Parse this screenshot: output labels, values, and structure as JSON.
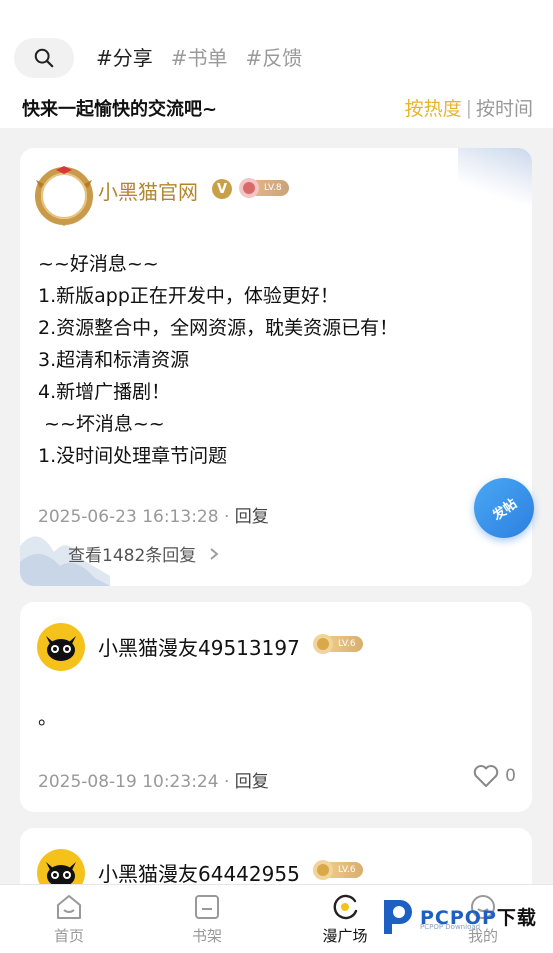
{
  "header": {
    "tags": [
      {
        "label": "#分享",
        "active": true
      },
      {
        "label": "#书单",
        "active": false
      },
      {
        "label": "#反馈",
        "active": false
      }
    ],
    "subtitle": "快来一起愉快的交流吧~",
    "sort": {
      "hot": "按热度",
      "time": "按时间",
      "selected": "hot"
    }
  },
  "posts": [
    {
      "username": "小黑猫官网",
      "verified_badge": "V",
      "level": "LV.8",
      "content": "~~好消息~~\n1.新版app正在开发中，体验更好！\n2.资源整合中，全网资源，耽美资源已有！\n3.超清和标清资源\n4.新增广播剧！\n ~~坏消息~~\n1.没时间处理章节问题",
      "timestamp": "2025-06-23 16:13:28",
      "reply_label": "回复",
      "view_replies": "查看1482条回复"
    },
    {
      "username": "小黑猫漫友49513197",
      "level": "LV.6",
      "avatar_text": "小黑猫",
      "content": "。",
      "timestamp": "2025-08-19 10:23:24",
      "reply_label": "回复",
      "likes": "0"
    },
    {
      "username": "小黑猫漫友64442955",
      "level": "LV.6"
    }
  ],
  "fab": {
    "label": "发帖"
  },
  "tabbar": [
    {
      "label": "首页",
      "icon": "home-icon",
      "active": false
    },
    {
      "label": "书架",
      "icon": "bookshelf-icon",
      "active": false
    },
    {
      "label": "漫广场",
      "icon": "plaza-icon",
      "active": true
    },
    {
      "label": "我的",
      "icon": "profile-icon",
      "active": false
    }
  ],
  "watermark": {
    "brand": "PCPOP",
    "suffix": "下载",
    "sub": "PCPOP Download"
  },
  "colors": {
    "accent": "#e7b52c",
    "gold_name": "#b3862e",
    "fab_blue": "#2d7fe0"
  }
}
